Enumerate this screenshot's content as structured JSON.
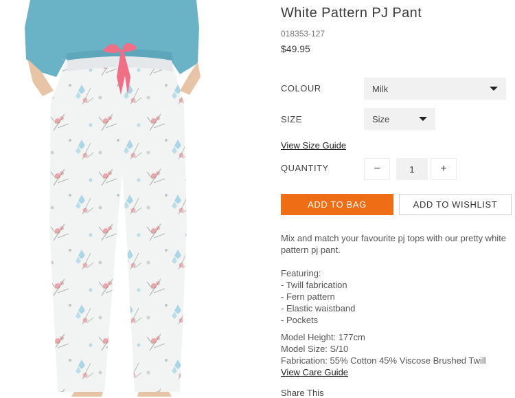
{
  "product": {
    "title": "White Pattern PJ Pant",
    "sku": "018353-127",
    "price": "$49.95"
  },
  "colour": {
    "label": "COLOUR",
    "selected": "Milk"
  },
  "size": {
    "label": "SIZE",
    "selected": "Size",
    "guide_link": "View Size Guide"
  },
  "quantity": {
    "label": "QUANTITY",
    "value": "1",
    "decrement": "−",
    "increment": "+"
  },
  "actions": {
    "add_to_bag": "ADD TO BAG",
    "add_to_wishlist": "ADD TO WISHLIST"
  },
  "description": {
    "intro": "Mix and match your favourite pj tops with our pretty white pattern pj pant.",
    "featuring_heading": "Featuring:",
    "features": [
      "- Twill fabrication",
      "- Fern pattern",
      "- Elastic waistband",
      "- Pockets"
    ],
    "model_height": "Model Height: 177cm",
    "model_size": "Model Size: S/10",
    "fabrication": "Fabrication: 55% Cotton 45% Viscose Brushed Twill",
    "care_link": "View Care Guide"
  },
  "share": {
    "label": "Share This"
  },
  "image": {
    "top_color": "#6ab3c6",
    "pant_color": "#f2f3f3",
    "tie_color": "#ef6f86"
  }
}
